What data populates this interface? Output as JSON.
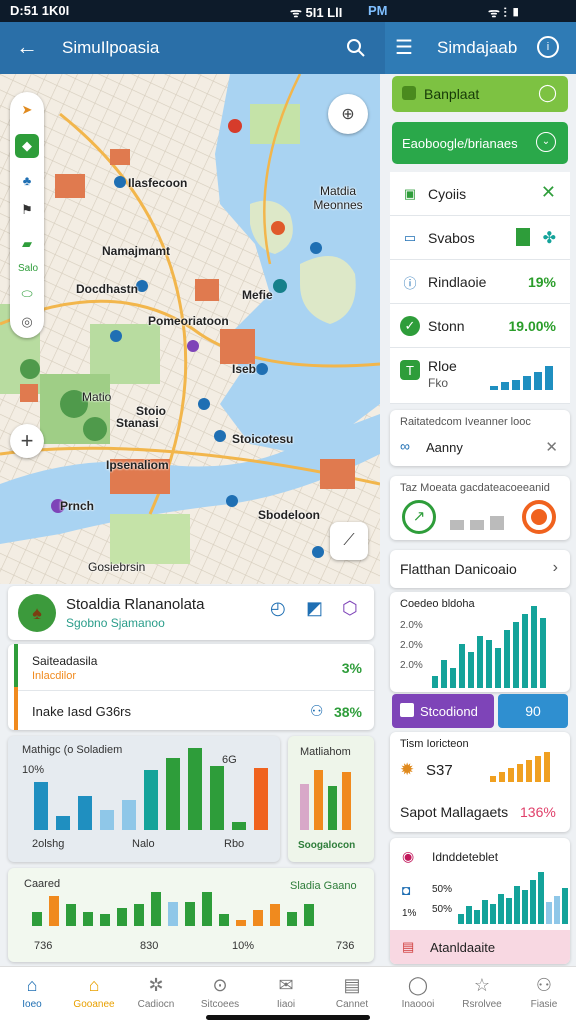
{
  "status_bar": {
    "time": "D:51 1K0I",
    "left_icons": "ᯤ 5I1 LlI",
    "pm": "PM",
    "right_icons": "ᯤ ⫶ ▮"
  },
  "left_header": {
    "title": "SimuIlpoasia"
  },
  "right_header": {
    "title": "Simdajaab"
  },
  "map": {
    "labels": [
      "Ilasfecoon",
      "Namajmamt",
      "Docdhastn",
      "Pomeoriatoon",
      "Stanasi",
      "Stoicotesu",
      "Ipsenaliom",
      "Prnch",
      "Stoio",
      "Sbodeloon",
      "Mefie",
      "Iseb",
      "Matdia Meonnes",
      "Matio",
      "Gosiebrsin"
    ],
    "tools": [
      "nav-arrow-icon",
      "layers-icon",
      "tree-icon",
      "flag-icon",
      "region-icon",
      "pin-icon",
      "target-icon"
    ],
    "tool_text": "Salo"
  },
  "place_card": {
    "title": "Stoaldia Rlananolata",
    "subtitle": "Sgobno Sjamanoo"
  },
  "stat_card": {
    "row1_label": "Saiteadasila",
    "row1_sub": "Inlacdilor",
    "row1_value": "3%",
    "row2_label": "Inake Iasd  G36rs",
    "row2_value": "38%"
  },
  "chart1": {
    "title": "Mathigc (o Soladiem",
    "ytick": "10%",
    "corner": "6G",
    "xlabels": [
      "2olshg",
      "Nalo",
      "Rbo"
    ]
  },
  "chart2": {
    "title": "Matliahom",
    "xlabel": "Soogalocon"
  },
  "chart3": {
    "title": "Caared",
    "title2": "Sladia Gaano",
    "xlabels": [
      "736",
      "830",
      "10%",
      "736"
    ]
  },
  "right_panel": {
    "btn1": "Banplaat",
    "btn2": "Eaoboogle/brianaes",
    "rows": [
      {
        "label": "Cyoiis",
        "value": ""
      },
      {
        "label": "Svabos",
        "value": ""
      },
      {
        "label": "Rindlaoie",
        "value": "19%"
      },
      {
        "label": "Stonn",
        "value": "19.00%"
      },
      {
        "label": "Rloe",
        "sub": "Fko",
        "value": ""
      }
    ],
    "section1_title": "Raitatedcom Iveanner looc",
    "section1_item": "Aanny",
    "section2_title": "Taz Moeata gacdateacoeeanid",
    "nav_row": "Flatthan Danicoaio",
    "chart_title": "Coedeo bldoha",
    "chart_yticks": [
      "2.0%",
      "2.0%",
      "2.0%"
    ],
    "btn_purple": "Stcodiond",
    "btn_blue": "90",
    "metric_title": "Tism Ioricteon",
    "metric_value": "S37",
    "metric_footer": "Sapot Mallagaets",
    "metric_footer_value": "136%",
    "bottom_title": "Idnddeteblet",
    "bottom_ticks": [
      "50%",
      "50%",
      "1%"
    ],
    "bottom_footer": "Atanldaaite"
  },
  "nav": [
    "Ioeo",
    "Gooanee",
    "Cadiocn",
    "Sitcoees",
    "Iiaoi",
    "Cannet",
    "Inaoooi",
    "Rsrolvee",
    "Fiasie"
  ],
  "colors": {
    "primary": "#2a6fa8",
    "green": "#2e9d3a",
    "teal": "#14a39a",
    "orange": "#f08a1e",
    "purple": "#7e44b8",
    "blue": "#2f8fd0"
  }
}
